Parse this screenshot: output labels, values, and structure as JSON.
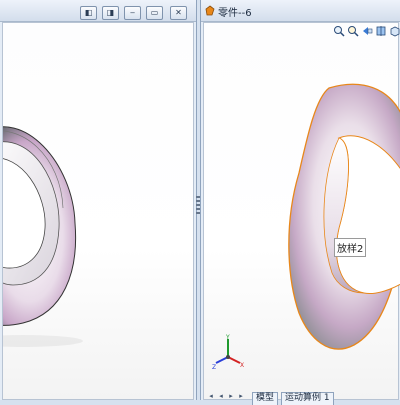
{
  "right_window": {
    "title": "零件--6",
    "ring_tag": "放样2",
    "tabs": [
      "模型",
      "运动算例 1"
    ]
  },
  "colors": {
    "selection_edge": "#e8871a",
    "chrome": "#d6e1ef",
    "viewport_bg": "#ffffff"
  },
  "icons": {
    "left_titlebar": [
      "restore-icon",
      "restore-icon",
      "minimize-icon",
      "maximize-icon",
      "close-icon"
    ],
    "right_titlebar": [
      "part-icon"
    ],
    "view_toolbar": [
      "zoom-fit-icon",
      "zoom-area-icon",
      "previous-view-icon",
      "section-view-icon",
      "view-orientation-icon"
    ],
    "triad": "coordinate-triad-icon"
  }
}
